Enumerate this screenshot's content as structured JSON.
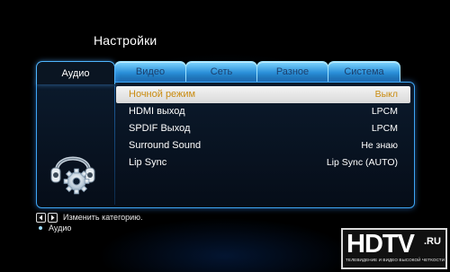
{
  "page": {
    "title": "Настройки"
  },
  "tabs": [
    {
      "label": "Аудио",
      "active": true
    },
    {
      "label": "Видео",
      "active": false
    },
    {
      "label": "Сеть",
      "active": false
    },
    {
      "label": "Разное",
      "active": false
    },
    {
      "label": "Система",
      "active": false
    }
  ],
  "settings": [
    {
      "label": "Ночной режим",
      "value": "Выкл",
      "selected": true
    },
    {
      "label": "HDMI выход",
      "value": "LPCM",
      "selected": false
    },
    {
      "label": "SPDIF Выход",
      "value": "LPCM",
      "selected": false
    },
    {
      "label": "Surround Sound",
      "value": "Не знаю",
      "selected": false
    },
    {
      "label": "Lip Sync",
      "value": "Lip Sync (AUTO)",
      "selected": false
    }
  ],
  "help": {
    "change_category": "Изменить категорию.",
    "current_category": "Аудио"
  },
  "watermark": {
    "main": "HDTV",
    "suffix": ".RU",
    "tagline": "ТЕЛЕВИДЕНИЕ И ВИДЕО ВЫСОКОЙ ЧЕТКОСТИ"
  },
  "colors": {
    "accent": "#3ea6f5",
    "selected_text": "#c98b10",
    "tab_inactive": "#2a8fd8"
  },
  "icons": {
    "category": "headphones-gear-icon",
    "left_key": "arrow-left-icon",
    "right_key": "arrow-right-icon"
  }
}
